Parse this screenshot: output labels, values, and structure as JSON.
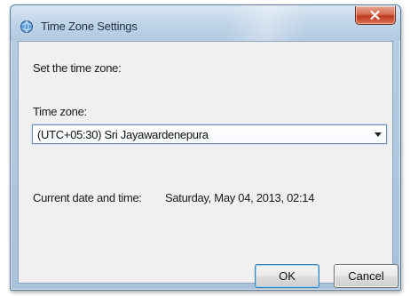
{
  "window": {
    "title": "Time Zone Settings",
    "close_glyph": "x",
    "icon": "clock-globe-icon"
  },
  "content": {
    "instruction": "Set the time zone:",
    "timezone_label": "Time zone:",
    "timezone_selected": "(UTC+05:30) Sri Jayawardenepura",
    "datetime_label": "Current date and time:",
    "datetime_value": "Saturday, May 04, 2013, 02:14"
  },
  "buttons": {
    "ok_label": "OK",
    "cancel_label": "Cancel"
  },
  "colors": {
    "frame": "#b6cce2",
    "close_button": "#c8452a",
    "client_bg": "#f0f0f0",
    "focus_border": "#3c7fb1"
  }
}
